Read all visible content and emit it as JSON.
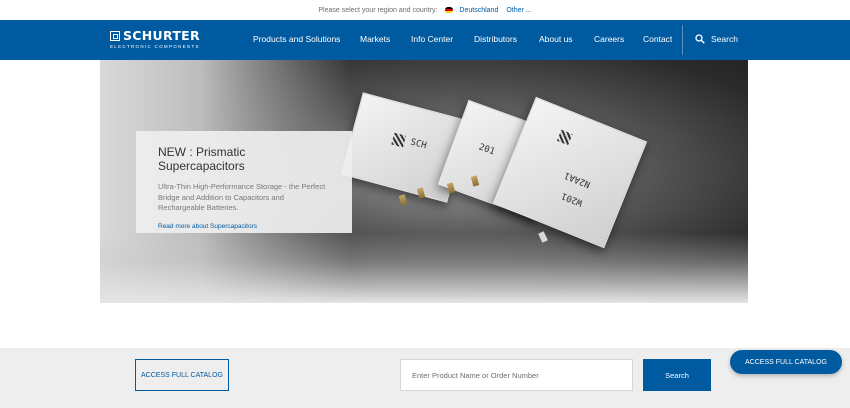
{
  "topbar": {
    "prompt": "Please select your region and country:",
    "current_region": "Deutschland",
    "other": "Other ..."
  },
  "brand": {
    "name": "SCHURTER",
    "tagline": "ELECTRONIC COMPONENTS"
  },
  "nav": {
    "items": [
      {
        "label": "Products and Solutions"
      },
      {
        "label": "Markets"
      },
      {
        "label": "Info Center"
      },
      {
        "label": "Distributors"
      },
      {
        "label": "About us"
      },
      {
        "label": "Careers"
      },
      {
        "label": "Contact"
      }
    ],
    "search_label": "Search"
  },
  "hero": {
    "title": "NEW : Prismatic Supercapacitors",
    "description": "Ultra-Thin High-Performance Storage - the Perfect Bridge and Addition to Capacitors and Rechargeable Batteries.",
    "link": "Read more about Supercapacitors",
    "cap_labels": [
      "SCH",
      "201",
      "N2AA1",
      "W201"
    ]
  },
  "bottom": {
    "catalog_button": "ACCESS FULL CATALOG",
    "search_placeholder": "Enter Product Name or Order Number",
    "search_button": "Search",
    "floating_button": "ACCESS FULL CATALOG"
  },
  "colors": {
    "brand_blue": "#005aa0",
    "panel_gray": "#eeeeee"
  },
  "icons": [
    "search-icon",
    "germany-flag-icon",
    "schurter-logo-icon"
  ]
}
